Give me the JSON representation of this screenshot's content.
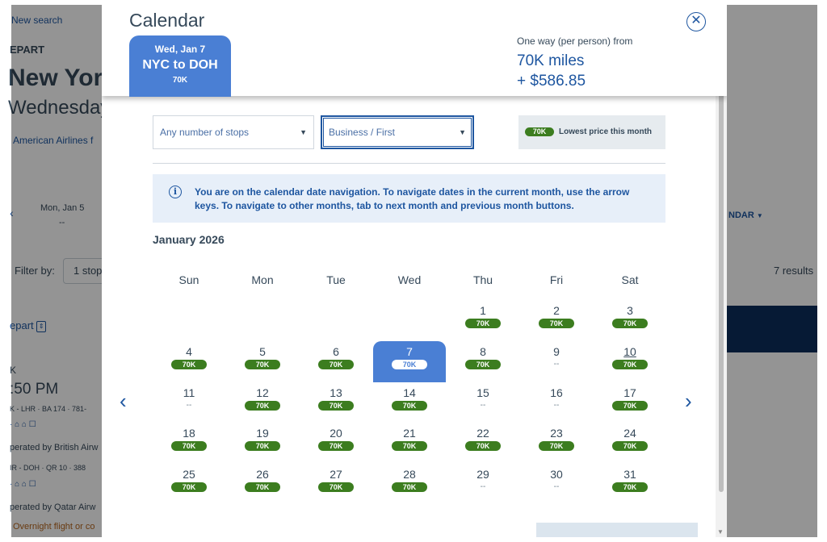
{
  "background": {
    "new_search": "New search",
    "depart": "EPART",
    "city": "New Yor",
    "day": "Wednesday",
    "airline": "American Airlines f",
    "date_nav": "Mon, Jan 5",
    "date_nav_price": "--",
    "nav_left": "‹",
    "calendar_link": "NDAR",
    "filter_by": "Filter by:",
    "filter_stops": "1 stop",
    "results": "7 results",
    "sort_depart": "epart",
    "r1": "K",
    "r2": ":50 PM",
    "r3": "K - LHR",
    "r3b": "BA 174",
    "r3c": "781-",
    "r5": "perated by British Airw",
    "r6": "IR - DOH",
    "r6b": "QR 10",
    "r6c": "388",
    "r8": "perated by Qatar Airw",
    "r9": "Overnight flight or co"
  },
  "modal": {
    "title": "Calendar",
    "selected_tab": {
      "date": "Wed, Jan 7",
      "route": "NYC to DOH",
      "price": "70K"
    },
    "price_label": "One way (per person) from",
    "price_miles": "70K miles",
    "price_usd": "+ $586.85",
    "close_label": "⊗",
    "stops_dropdown": "Any number of stops",
    "cabin_dropdown": "Business / First",
    "legend_pill": "70K",
    "legend_text": "Lowest price this month",
    "info_text": "You are on the calendar date navigation. To navigate dates in the current month, use the arrow keys. To navigate to other months, tab to next month and previous month buttons.",
    "info_icon": "i",
    "month_label": "January 2026",
    "prev_arrow": "‹",
    "next_arrow": "›",
    "weekdays": [
      "Sun",
      "Mon",
      "Tue",
      "Wed",
      "Thu",
      "Fri",
      "Sat"
    ],
    "days": [
      {
        "d": "1",
        "p": "70K"
      },
      {
        "d": "2",
        "p": "70K"
      },
      {
        "d": "3",
        "p": "70K"
      },
      {
        "d": "4",
        "p": "70K"
      },
      {
        "d": "5",
        "p": "70K"
      },
      {
        "d": "6",
        "p": "70K"
      },
      {
        "d": "7",
        "p": "70K",
        "selected": true
      },
      {
        "d": "8",
        "p": "70K"
      },
      {
        "d": "9",
        "p": "--"
      },
      {
        "d": "10",
        "p": "70K",
        "underline": true
      },
      {
        "d": "11",
        "p": "--"
      },
      {
        "d": "12",
        "p": "70K"
      },
      {
        "d": "13",
        "p": "70K"
      },
      {
        "d": "14",
        "p": "70K"
      },
      {
        "d": "15",
        "p": "--"
      },
      {
        "d": "16",
        "p": "--"
      },
      {
        "d": "17",
        "p": "70K"
      },
      {
        "d": "18",
        "p": "70K"
      },
      {
        "d": "19",
        "p": "70K"
      },
      {
        "d": "20",
        "p": "70K"
      },
      {
        "d": "21",
        "p": "70K"
      },
      {
        "d": "22",
        "p": "70K"
      },
      {
        "d": "23",
        "p": "70K"
      },
      {
        "d": "24",
        "p": "70K"
      },
      {
        "d": "25",
        "p": "70K"
      },
      {
        "d": "26",
        "p": "70K"
      },
      {
        "d": "27",
        "p": "70K"
      },
      {
        "d": "28",
        "p": "70K"
      },
      {
        "d": "29",
        "p": "--"
      },
      {
        "d": "30",
        "p": "--"
      },
      {
        "d": "31",
        "p": "70K"
      }
    ],
    "first_weekday": 4
  },
  "colors": {
    "accent": "#1e56a0",
    "selected": "#4a7fd4",
    "price_pill": "#3c7d1f",
    "info_bg": "#e7eff9"
  }
}
